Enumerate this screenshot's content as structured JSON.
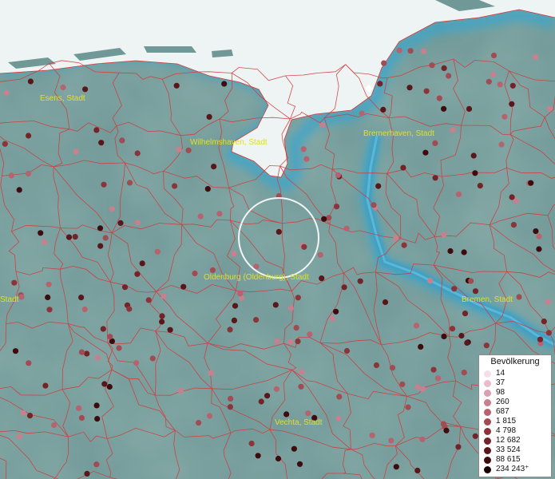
{
  "map": {
    "city_labels": [
      {
        "name": "Esens, Stadt"
      },
      {
        "name": "Wilhelmshaven, Stadt"
      },
      {
        "name": "Bremerhaven, Stadt"
      },
      {
        "name": "Oldenburg (Oldenburg), Stadt"
      },
      {
        "name": "Bremen, Stadt"
      },
      {
        "name": "Vechta, Stadt"
      },
      {
        "name": "Stadt"
      }
    ],
    "colors": {
      "land": "#6f9896",
      "sea": "#eef3f4",
      "coast_glow": "#3aa6cc",
      "border": "#d23a3a",
      "label": "#e0e020"
    }
  },
  "legend": {
    "title": "Bevölkerung",
    "items": [
      {
        "label": "14",
        "color": "#f4dfe8"
      },
      {
        "label": "37",
        "color": "#e8bccb"
      },
      {
        "label": "98",
        "color": "#d9a1b0"
      },
      {
        "label": "260",
        "color": "#c8808f"
      },
      {
        "label": "687",
        "color": "#b5636e"
      },
      {
        "label": "1 815",
        "color": "#a14b53"
      },
      {
        "label": "4 798",
        "color": "#8a3539"
      },
      {
        "label": "12 682",
        "color": "#722428"
      },
      {
        "label": "33 524",
        "color": "#5a171b"
      },
      {
        "label": "88 615",
        "color": "#3e0c0f"
      },
      {
        "label": "234 243⁺",
        "color": "#1a0305"
      }
    ]
  }
}
